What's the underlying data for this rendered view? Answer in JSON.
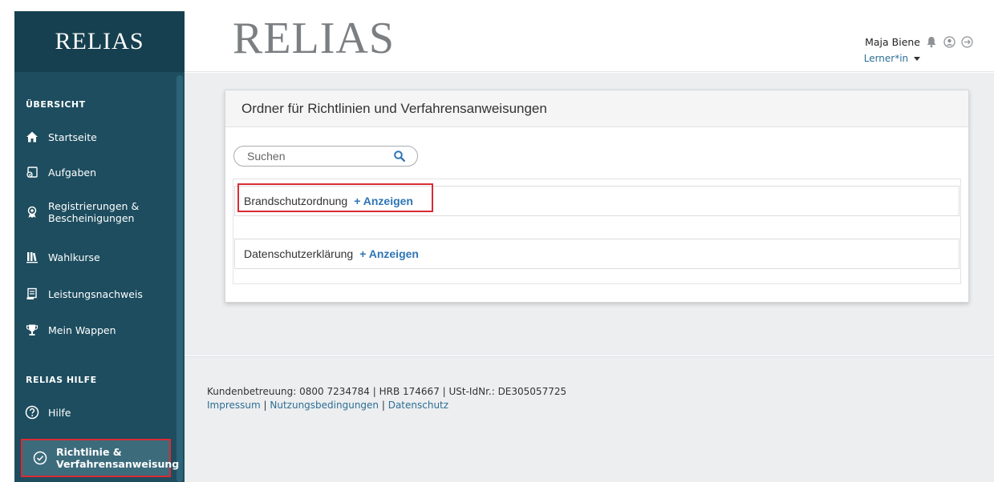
{
  "app": {
    "logo_sidebar": "RELIAS",
    "logo_main": "RELIAS"
  },
  "header": {
    "user_name": "Maja Biene",
    "user_role": "Lerner*in",
    "icons": [
      "bell-icon",
      "user-circle-icon",
      "logout-icon"
    ]
  },
  "sidebar": {
    "section_overview": "ÜBERSICHT",
    "items": [
      {
        "label": "Startseite",
        "icon": "home-icon"
      },
      {
        "label": "Aufgaben",
        "icon": "tasks-icon"
      },
      {
        "label": "Registrierungen & Bescheinigungen",
        "icon": "badge-icon"
      },
      {
        "label": "Wahlkurse",
        "icon": "library-icon"
      },
      {
        "label": "Leistungsnachweis",
        "icon": "transcript-icon"
      },
      {
        "label": "Mein Wappen",
        "icon": "trophy-icon"
      }
    ],
    "section_help": "RELIAS HILFE",
    "help_items": [
      {
        "label": "Hilfe",
        "icon": "question-icon"
      },
      {
        "label": "Richtlinie & Verfahrensanweisung",
        "icon": "check-circle-icon",
        "active": true
      }
    ]
  },
  "main": {
    "panel_title": "Ordner für Richtlinien und Verfahrensanweisungen",
    "search_placeholder": "Suchen",
    "folders": [
      {
        "name": "Brandschutzordnung",
        "action": "+ Anzeigen"
      },
      {
        "name": "Datenschutzerklärung",
        "action": "+ Anzeigen"
      }
    ]
  },
  "footer": {
    "line1": "Kundenbetreuung: 0800 7234784 | HRB 174667 | USt-IdNr.: DE305057725",
    "links": [
      "Impressum",
      "Nutzungsbedingungen",
      "Datenschutz"
    ],
    "separator": " | "
  },
  "colors": {
    "sidebar_bg": "#1d4d5f",
    "accent_link": "#2e75b6",
    "highlight_red": "#d92b34",
    "main_bg": "#eceef0"
  }
}
